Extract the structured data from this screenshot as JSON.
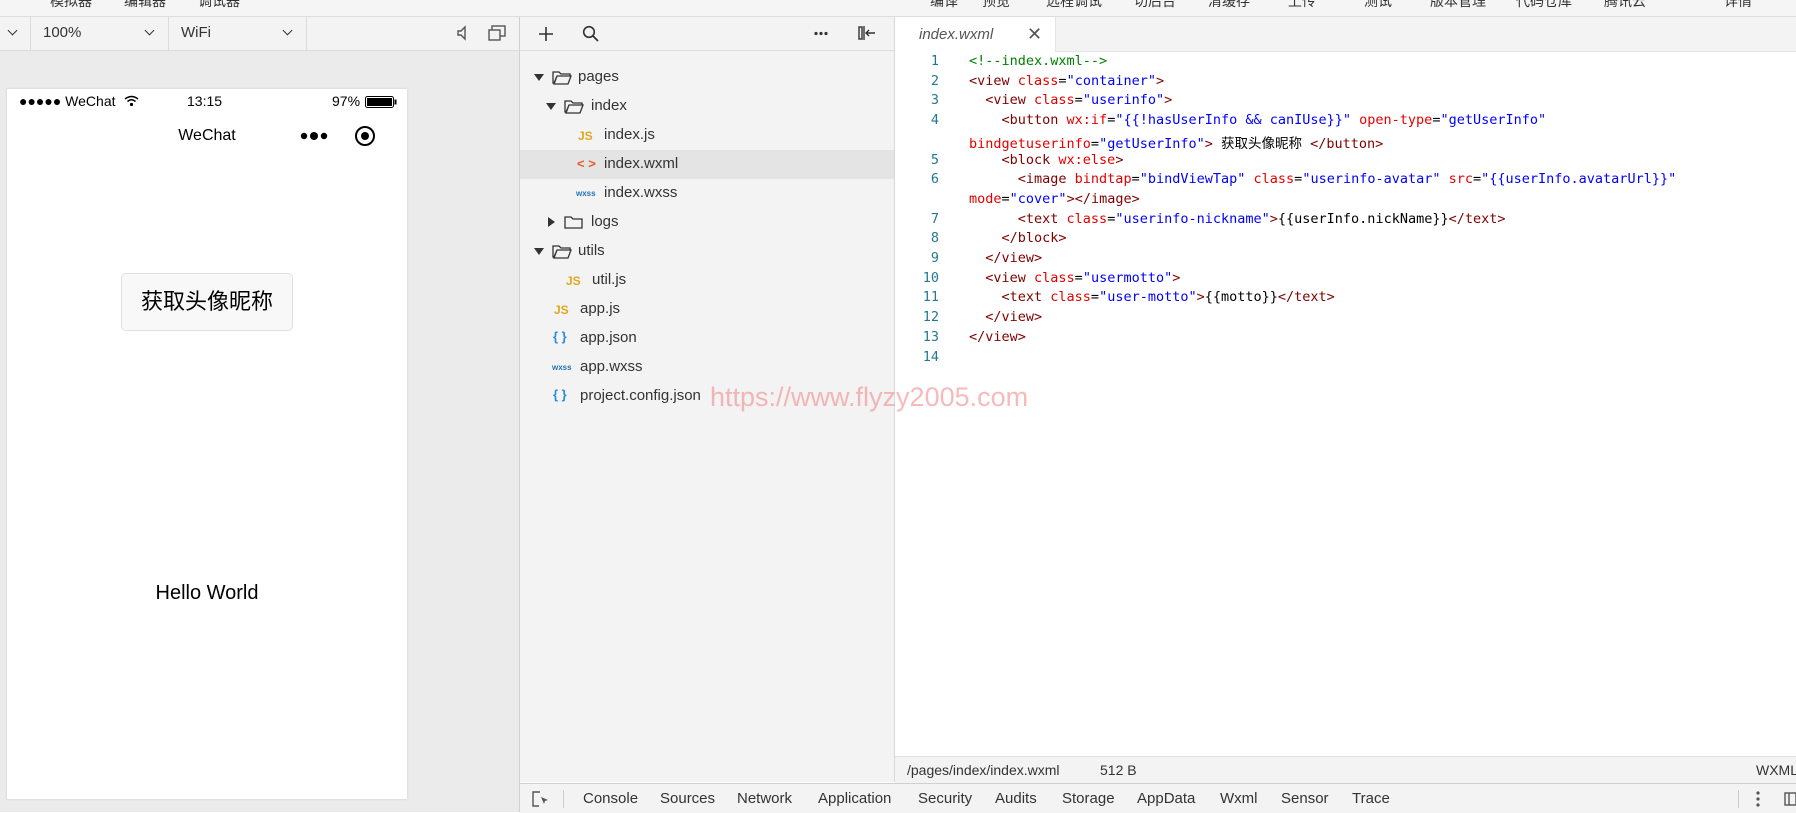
{
  "top_menu": [
    "模拟器",
    "编辑器",
    "调试器",
    "编译",
    "预览",
    "远程调试",
    "切后台",
    "清缓存",
    "上传",
    "测试",
    "版本管理",
    "代码仓库",
    "腾讯云",
    "详情"
  ],
  "simulator": {
    "zoom": "100%",
    "network": "WiFi",
    "status_bar": {
      "signal": "●●●●● WeChat",
      "time": "13:15",
      "battery": "97%"
    },
    "nav_title": "WeChat",
    "button_label": "获取头像昵称",
    "motto": "Hello World"
  },
  "explorer": {
    "items": [
      {
        "label": "pages",
        "type": "folder-open"
      },
      {
        "label": "index",
        "type": "folder-open"
      },
      {
        "label": "index.js",
        "type": "js"
      },
      {
        "label": "index.wxml",
        "type": "wxml"
      },
      {
        "label": "index.wxss",
        "type": "wxss"
      },
      {
        "label": "logs",
        "type": "folder-closed"
      },
      {
        "label": "utils",
        "type": "folder-open"
      },
      {
        "label": "util.js",
        "type": "js"
      },
      {
        "label": "app.js",
        "type": "js"
      },
      {
        "label": "app.json",
        "type": "json"
      },
      {
        "label": "app.wxss",
        "type": "wxss"
      },
      {
        "label": "project.config.json",
        "type": "json"
      }
    ],
    "icon_glyphs": {
      "js": "JS",
      "wxml": "< >",
      "wxss": "wxss",
      "json": "{ }"
    }
  },
  "editor": {
    "tab_title": "index.wxml",
    "line_numbers": [
      "1",
      "2",
      "3",
      "4",
      "5",
      "6",
      "7",
      "8",
      "9",
      "10",
      "11",
      "12",
      "13",
      "14"
    ],
    "lines": [
      [
        {
          "t": "<!--index.wxml-->",
          "c": "c"
        }
      ],
      [
        {
          "t": "<view ",
          "c": "tag"
        },
        {
          "t": "class",
          "c": "attr"
        },
        {
          "t": "=",
          "c": "d"
        },
        {
          "t": "\"container\"",
          "c": "str"
        },
        {
          "t": ">",
          "c": "tag"
        }
      ],
      [
        {
          "t": "  <view ",
          "c": "tag"
        },
        {
          "t": "class",
          "c": "attr"
        },
        {
          "t": "=",
          "c": "d"
        },
        {
          "t": "\"userinfo\"",
          "c": "str"
        },
        {
          "t": ">",
          "c": "tag"
        }
      ],
      [
        {
          "t": "    <button ",
          "c": "tag"
        },
        {
          "t": "wx:if",
          "c": "attr"
        },
        {
          "t": "=",
          "c": "d"
        },
        {
          "t": "\"{{!hasUserInfo && canIUse}}\"",
          "c": "str"
        },
        {
          "t": " open-type",
          "c": "attr"
        },
        {
          "t": "=",
          "c": "d"
        },
        {
          "t": "\"getUserInfo\"",
          "c": "str"
        }
      ],
      [
        {
          "t": "bindgetuserinfo",
          "c": "attr"
        },
        {
          "t": "=",
          "c": "d"
        },
        {
          "t": "\"getUserInfo\"",
          "c": "str"
        },
        {
          "t": ">",
          "c": "tag"
        },
        {
          "t": " 获取头像昵称 ",
          "c": "d"
        },
        {
          "t": "</button>",
          "c": "tag"
        }
      ],
      [
        {
          "t": "    <block ",
          "c": "tag"
        },
        {
          "t": "wx:else",
          "c": "attr"
        },
        {
          "t": ">",
          "c": "tag"
        }
      ],
      [
        {
          "t": "      <image ",
          "c": "tag"
        },
        {
          "t": "bindtap",
          "c": "attr"
        },
        {
          "t": "=",
          "c": "d"
        },
        {
          "t": "\"bindViewTap\"",
          "c": "str"
        },
        {
          "t": " class",
          "c": "attr"
        },
        {
          "t": "=",
          "c": "d"
        },
        {
          "t": "\"userinfo-avatar\"",
          "c": "str"
        },
        {
          "t": " src",
          "c": "attr"
        },
        {
          "t": "=",
          "c": "d"
        },
        {
          "t": "\"{{userInfo.avatarUrl}}\"",
          "c": "str"
        }
      ],
      [
        {
          "t": "mode",
          "c": "attr"
        },
        {
          "t": "=",
          "c": "d"
        },
        {
          "t": "\"cover\"",
          "c": "str"
        },
        {
          "t": "></image>",
          "c": "tag"
        }
      ],
      [
        {
          "t": "      <text ",
          "c": "tag"
        },
        {
          "t": "class",
          "c": "attr"
        },
        {
          "t": "=",
          "c": "d"
        },
        {
          "t": "\"userinfo-nickname\"",
          "c": "str"
        },
        {
          "t": ">",
          "c": "tag"
        },
        {
          "t": "{{userInfo.nickName}}",
          "c": "d"
        },
        {
          "t": "</text>",
          "c": "tag"
        }
      ],
      [
        {
          "t": "    </block>",
          "c": "tag"
        }
      ],
      [
        {
          "t": "  </view>",
          "c": "tag"
        }
      ],
      [
        {
          "t": "  <view ",
          "c": "tag"
        },
        {
          "t": "class",
          "c": "attr"
        },
        {
          "t": "=",
          "c": "d"
        },
        {
          "t": "\"usermotto\"",
          "c": "str"
        },
        {
          "t": ">",
          "c": "tag"
        }
      ],
      [
        {
          "t": "    <text ",
          "c": "tag"
        },
        {
          "t": "class",
          "c": "attr"
        },
        {
          "t": "=",
          "c": "d"
        },
        {
          "t": "\"user-motto\"",
          "c": "str"
        },
        {
          "t": ">",
          "c": "tag"
        },
        {
          "t": "{{motto}}",
          "c": "d"
        },
        {
          "t": "</text>",
          "c": "tag"
        }
      ],
      [
        {
          "t": "  </view>",
          "c": "tag"
        }
      ],
      [
        {
          "t": "</view>",
          "c": "tag"
        }
      ],
      [
        {
          "t": "",
          "c": "d"
        }
      ]
    ],
    "watermark": "https://www.flyzy2005.com",
    "status_path": "/pages/index/index.wxml",
    "status_size": "512 B",
    "status_lang": "WXML"
  },
  "devtools_tabs": [
    "Console",
    "Sources",
    "Network",
    "Application",
    "Security",
    "Audits",
    "Storage",
    "AppData",
    "Wxml",
    "Sensor",
    "Trace"
  ]
}
